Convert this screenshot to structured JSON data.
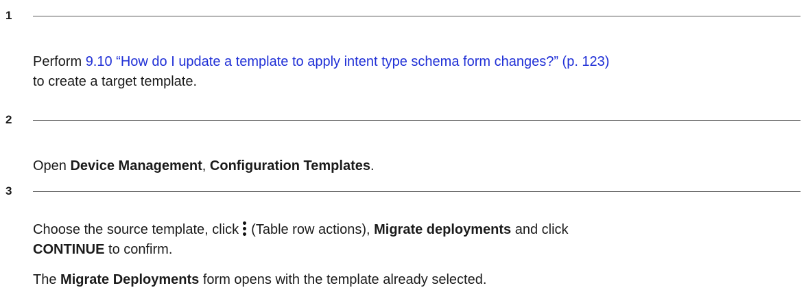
{
  "steps": [
    {
      "number": "1",
      "text_before_link": "Perform ",
      "link_text": "9.10 “How do I update a template to apply intent type schema form changes?” (p. 123)",
      "text_after_link": " to create a target template."
    },
    {
      "number": "2",
      "text_open": "Open ",
      "bold_1": "Device Management",
      "comma": ", ",
      "bold_2": "Configuration Templates",
      "period": "."
    },
    {
      "number": "3",
      "text_1": "Choose the source template, click",
      "icon": "more-vertical-icon",
      "text_2": "(Table row actions), ",
      "bold_1": "Migrate deployments",
      "text_3": " and click ",
      "bold_2": "CONTINUE",
      "text_4": " to confirm.",
      "result_prefix": "The ",
      "result_bold": "Migrate Deployments",
      "result_suffix": " form opens with the template already selected."
    }
  ]
}
